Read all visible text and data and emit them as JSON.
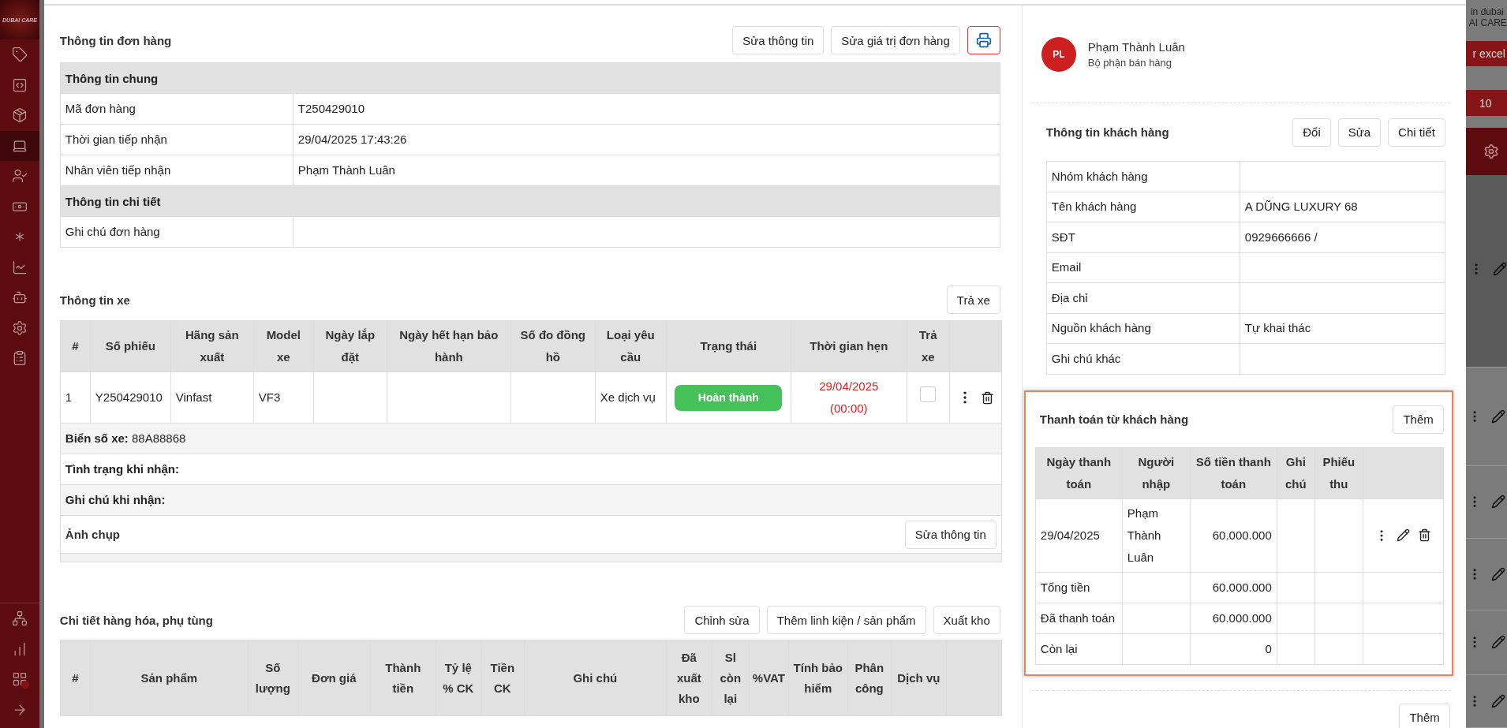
{
  "sidebar": {
    "logo": "DUBAI CARE",
    "items": [
      {
        "selected": false
      },
      {
        "selected": false
      },
      {
        "selected": false
      },
      {
        "selected": true
      },
      {
        "selected": false
      },
      {
        "selected": false
      },
      {
        "selected": false
      },
      {
        "selected": false
      },
      {
        "selected": false
      },
      {
        "selected": false
      },
      {
        "selected": false
      }
    ]
  },
  "order_info": {
    "title": "Thông tin đơn hàng",
    "buttons": [
      "Sửa thông tin",
      "Sửa giá trị đơn hàng"
    ],
    "sections": [
      {
        "heading": "Thông tin chung",
        "rows": [
          {
            "label": "Mã đơn hàng",
            "value": "T250429010"
          },
          {
            "label": "Thời gian tiếp nhận",
            "value": "29/04/2025 17:43:26"
          },
          {
            "label": "Nhân viên tiếp nhận",
            "value": "Phạm Thành Luân"
          }
        ]
      },
      {
        "heading": "Thông tin chi tiết",
        "rows": [
          {
            "label": "Ghi chú đơn hàng"
          }
        ]
      }
    ]
  },
  "vehicle": {
    "title": "Thông tin xe",
    "button": "Trả xe",
    "columns": [
      "#",
      "Số phiếu",
      "Hãng sản xuất",
      "Model xe",
      "Ngày lắp đặt",
      "Ngày hết hạn bảo hành",
      "Số đo đồng hồ",
      "Loại yêu cầu",
      "Trạng thái",
      "Thời gian hẹn",
      "Trả xe"
    ],
    "rows": [
      {
        "cells": [
          "1",
          "Y250429010",
          "Vinfast",
          "VF3",
          "",
          "",
          "",
          "Xe dịch vụ"
        ],
        "status": "Hoàn thành",
        "appointment_date": "29/04/2025",
        "appointment_time": "(00:00)",
        "returned": false
      }
    ],
    "details": [
      {
        "label": "Biển số xe:",
        "value": "88A88868"
      },
      {
        "label": "Tình trạng khi nhận:"
      },
      {
        "label": "Ghi chú khi nhận:"
      }
    ],
    "photo": {
      "label": "Ảnh chụp",
      "button": "Sửa thông tin"
    }
  },
  "products": {
    "title": "Chi tiết hàng hóa, phụ tùng",
    "buttons": [
      "Chỉnh sửa",
      "Thêm linh kiện / sản phẩm",
      "Xuất kho"
    ],
    "columns": [
      "#",
      "Sản phẩm",
      "Số lượng",
      "Đơn giá",
      "Thành tiền",
      "Tỷ lệ % CK",
      "Tiền CK",
      "Ghi chú",
      "Đã xuất kho",
      "Sl còn lại",
      "%VAT",
      "Tính bảo hiểm",
      "Phân công",
      "Dịch vụ"
    ]
  },
  "employee": {
    "initials": "PL",
    "name": "Phạm Thành Luân",
    "role": "Bộ phận bán hàng"
  },
  "customer": {
    "title": "Thông tin khách hàng",
    "buttons": [
      "Đổi",
      "Sửa",
      "Chi tiết"
    ],
    "rows": [
      {
        "label": "Nhóm khách hàng"
      },
      {
        "label": "Tên khách hàng",
        "value": "A DŨNG LUXURY 68"
      },
      {
        "label": "SĐT",
        "value": "0929666666 /"
      },
      {
        "label": "Email"
      },
      {
        "label": "Địa chỉ"
      },
      {
        "label": "Nguồn khách hàng",
        "value": "Tự khai thác"
      },
      {
        "label": "Ghi chú khác"
      }
    ]
  },
  "payments": {
    "title": "Thanh toán từ khách hàng",
    "button": "Thêm",
    "columns": [
      "Ngày thanh toán",
      "Người nhập",
      "Số tiền thanh toán",
      "Ghi chú",
      "Phiếu thu"
    ],
    "rows": [
      {
        "date": "29/04/2025",
        "entered_by": "Phạm Thành Luân",
        "amount": "60.000.000"
      }
    ],
    "summary": [
      {
        "label": "Tổng tiền",
        "amount": "60.000.000"
      },
      {
        "label": "Đã thanh toán",
        "amount": "60.000.000"
      },
      {
        "label": "Còn lại",
        "amount": "0"
      }
    ]
  },
  "next_section": {
    "button": "Thêm"
  },
  "background": {
    "texts": [
      "in dubai",
      "AI CARE"
    ],
    "export_button": "r excel",
    "count": "10"
  }
}
